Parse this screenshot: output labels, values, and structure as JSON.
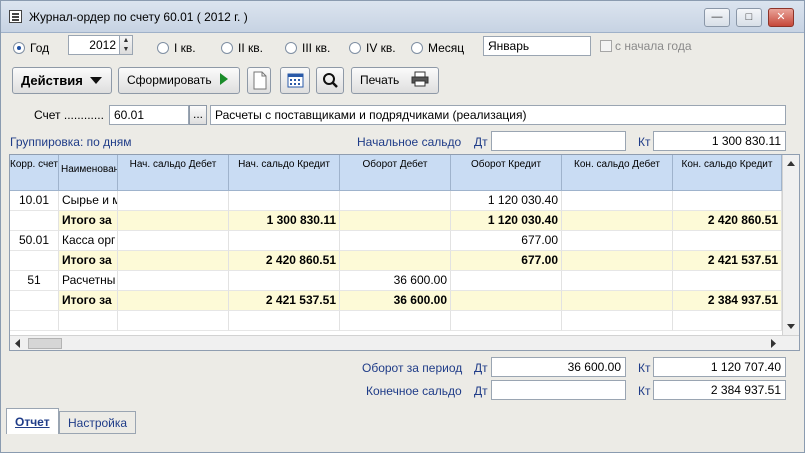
{
  "window": {
    "title": "Журнал-ордер по счету 60.01 ( 2012 г. )"
  },
  "period": {
    "options": [
      "Год",
      "I кв.",
      "II кв.",
      "III кв.",
      "IV кв.",
      "Месяц"
    ],
    "selected": "Год",
    "year": "2012",
    "month": "Январь",
    "from_start_label": "с начала года"
  },
  "toolbar": {
    "actions_label": "Действия",
    "generate_label": "Сформировать",
    "print_label": "Печать"
  },
  "account": {
    "label": "Счет ............",
    "value": "60.01",
    "browse": "...",
    "description": "Расчеты с поставщиками и подрядчиками (реализация)"
  },
  "grouping": "Группировка: по дням",
  "opening_balance": {
    "label": "Начальное сальдо",
    "dt_label": "Дт",
    "dt_value": "",
    "kt_label": "Кт",
    "kt_value": "1 300 830.11"
  },
  "table": {
    "headers": [
      "Корр. счет",
      "Наименование",
      "Нач. сальдо Дебет",
      "Нач. сальдо Кредит",
      "Оборот Дебет",
      "Оборот Кредит",
      "Кон. сальдо Дебет",
      "Кон. сальдо Кредит"
    ],
    "rows": [
      {
        "corr": "10.01",
        "name": "Сырье и м",
        "nsd": "",
        "nsk": "",
        "od": "",
        "ok": "1 120 030.40",
        "ksd": "",
        "ksk": "",
        "total": false
      },
      {
        "corr": "",
        "name": "Итого за",
        "nsd": "",
        "nsk": "1 300 830.11",
        "od": "",
        "ok": "1 120 030.40",
        "ksd": "",
        "ksk": "2 420 860.51",
        "total": true
      },
      {
        "corr": "50.01",
        "name": "Касса орг",
        "nsd": "",
        "nsk": "",
        "od": "",
        "ok": "677.00",
        "ksd": "",
        "ksk": "",
        "total": false
      },
      {
        "corr": "",
        "name": "Итого за",
        "nsd": "",
        "nsk": "2 420 860.51",
        "od": "",
        "ok": "677.00",
        "ksd": "",
        "ksk": "2 421 537.51",
        "total": true
      },
      {
        "corr": "51",
        "name": "Расчетны",
        "nsd": "",
        "nsk": "",
        "od": "36 600.00",
        "ok": "",
        "ksd": "",
        "ksk": "",
        "total": false
      },
      {
        "corr": "",
        "name": "Итого за",
        "nsd": "",
        "nsk": "2 421 537.51",
        "od": "36 600.00",
        "ok": "",
        "ksd": "",
        "ksk": "2 384 937.51",
        "total": true
      }
    ]
  },
  "turnover": {
    "label": "Оборот за период",
    "dt_label": "Дт",
    "dt_value": "36 600.00",
    "kt_label": "Кт",
    "kt_value": "1 120 707.40"
  },
  "closing_balance": {
    "label": "Конечное сальдо",
    "dt_label": "Дт",
    "dt_value": "",
    "kt_label": "Кт",
    "kt_value": "2 384 937.51"
  },
  "tabs": [
    "Отчет",
    "Настройка"
  ]
}
